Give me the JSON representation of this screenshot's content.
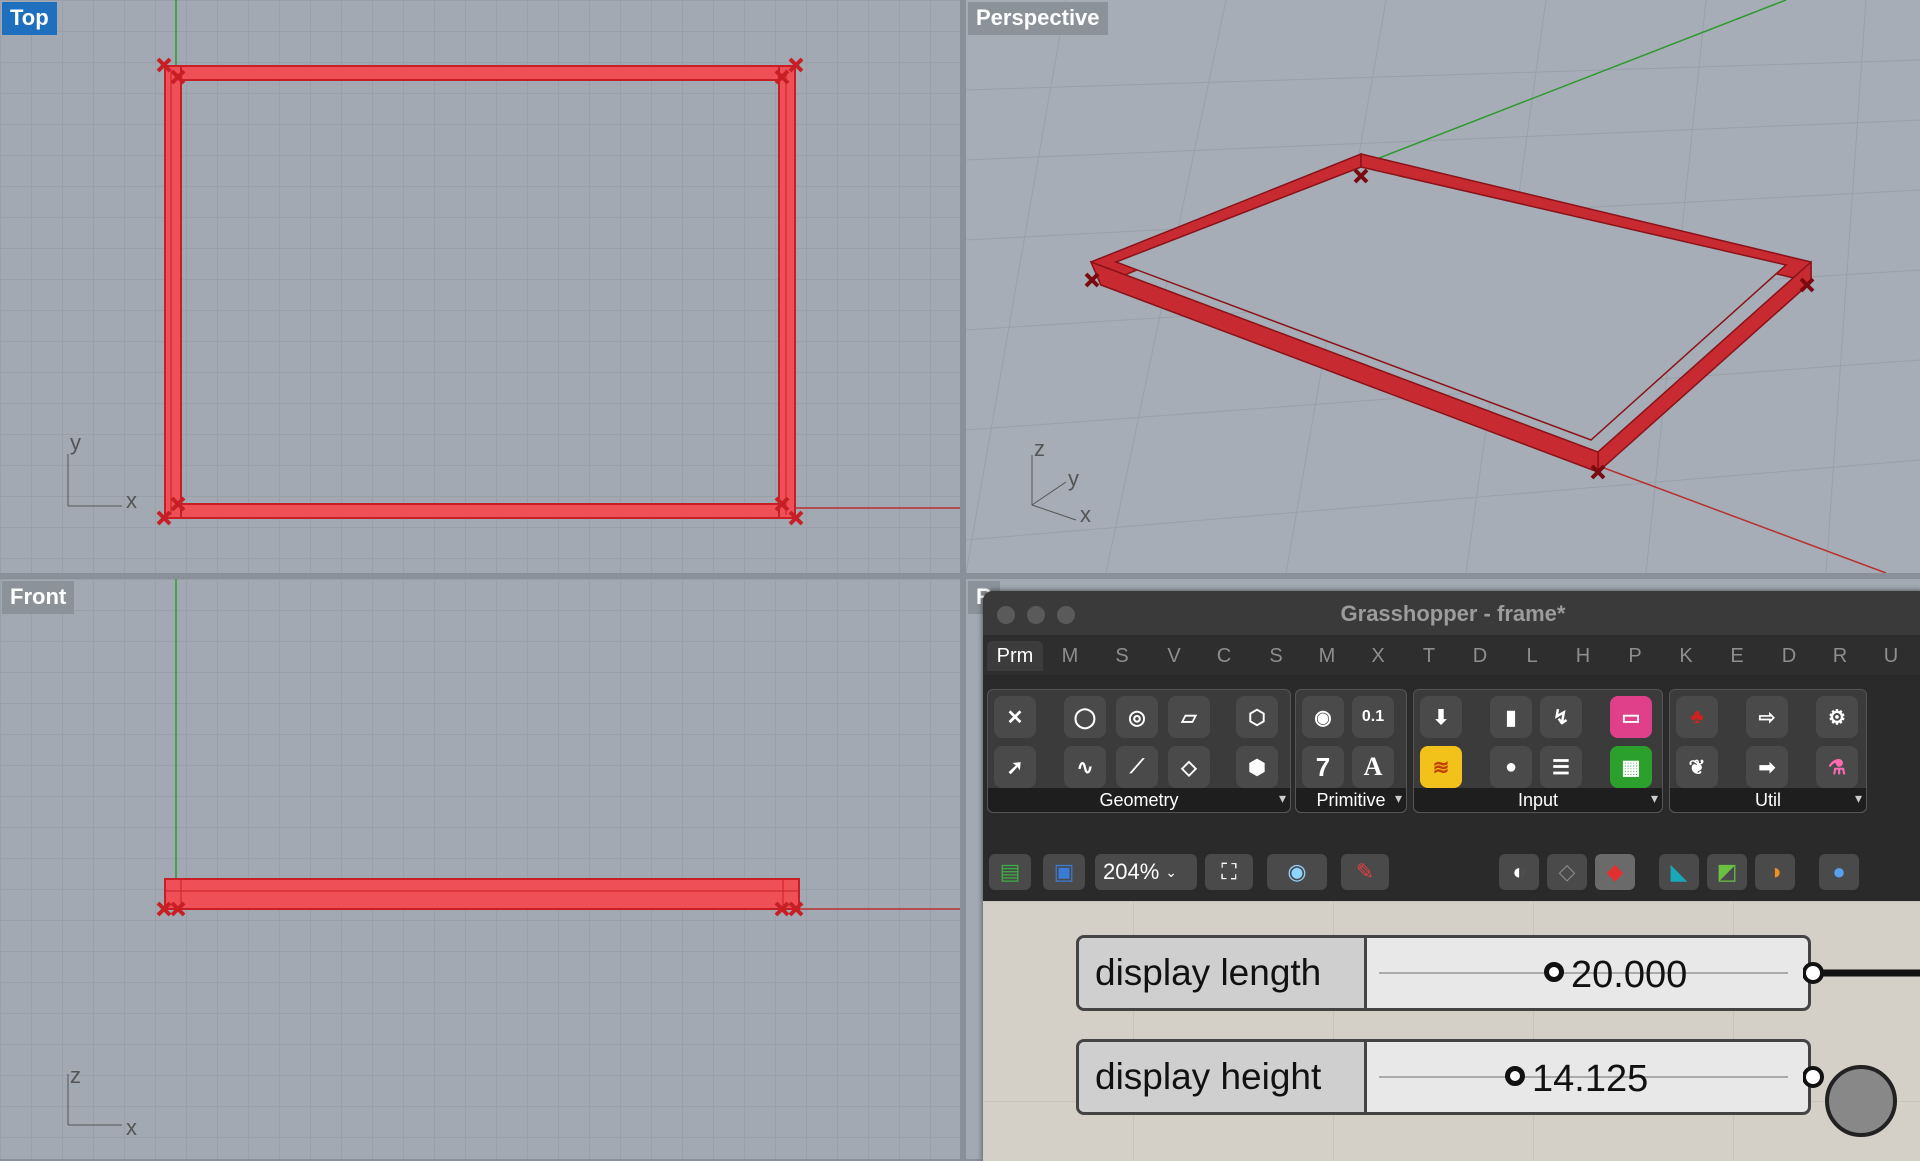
{
  "viewports": {
    "top": {
      "label": "Top",
      "axis_labels": {
        "vertical": "y",
        "horizontal": "x"
      }
    },
    "perspective": {
      "label": "Perspective",
      "axis_labels": {
        "z": "z",
        "y": "y",
        "x": "x"
      }
    },
    "front": {
      "label": "Front",
      "axis_labels": {
        "vertical": "z",
        "horizontal": "x"
      }
    },
    "right": {
      "label": "R"
    }
  },
  "grasshopper": {
    "title": "Grasshopper - frame*",
    "tabs": [
      "Prm",
      "M",
      "S",
      "V",
      "C",
      "S",
      "M",
      "X",
      "T",
      "D",
      "L",
      "H",
      "P",
      "K",
      "E",
      "D",
      "R",
      "U"
    ],
    "active_tab": "Prm",
    "panels": [
      {
        "label": "Geometry"
      },
      {
        "label": "Primitive"
      },
      {
        "label": "Input"
      },
      {
        "label": "Util"
      }
    ],
    "primitive_icons": {
      "number": "0.1",
      "integer": "7",
      "text": "A"
    },
    "zoom": "204%",
    "sliders": [
      {
        "name": "display length",
        "value": "20.000"
      },
      {
        "name": "display height",
        "value": "14.125"
      }
    ]
  },
  "colors": {
    "frame_fill": "#ef4f57",
    "frame_stroke": "#c81e26",
    "viewport_bg": "#a3a9b2",
    "active_label": "#1f6fbf",
    "x_axis": "#b83030",
    "y_axis": "#2e9a2e"
  },
  "icons": {
    "geometry": [
      "point-icon",
      "circle-icon",
      "arc-icon",
      "surface-icon",
      "box-icon",
      "vector-icon",
      "curve-icon",
      "line-icon",
      "plane-icon",
      "brep-icon"
    ],
    "primitive": [
      "boolean-icon",
      "number-icon",
      "integer-icon",
      "text-icon"
    ],
    "input": [
      "panel-icon",
      "toggle-icon",
      "slider-icon",
      "gradient-icon",
      "scribble-icon",
      "knob-icon",
      "list-icon",
      "swatch-icon"
    ],
    "util": [
      "cherry-icon",
      "arrow-icon",
      "gear-icon",
      "tree-icon",
      "arrow-right-icon",
      "flask-icon"
    ]
  }
}
